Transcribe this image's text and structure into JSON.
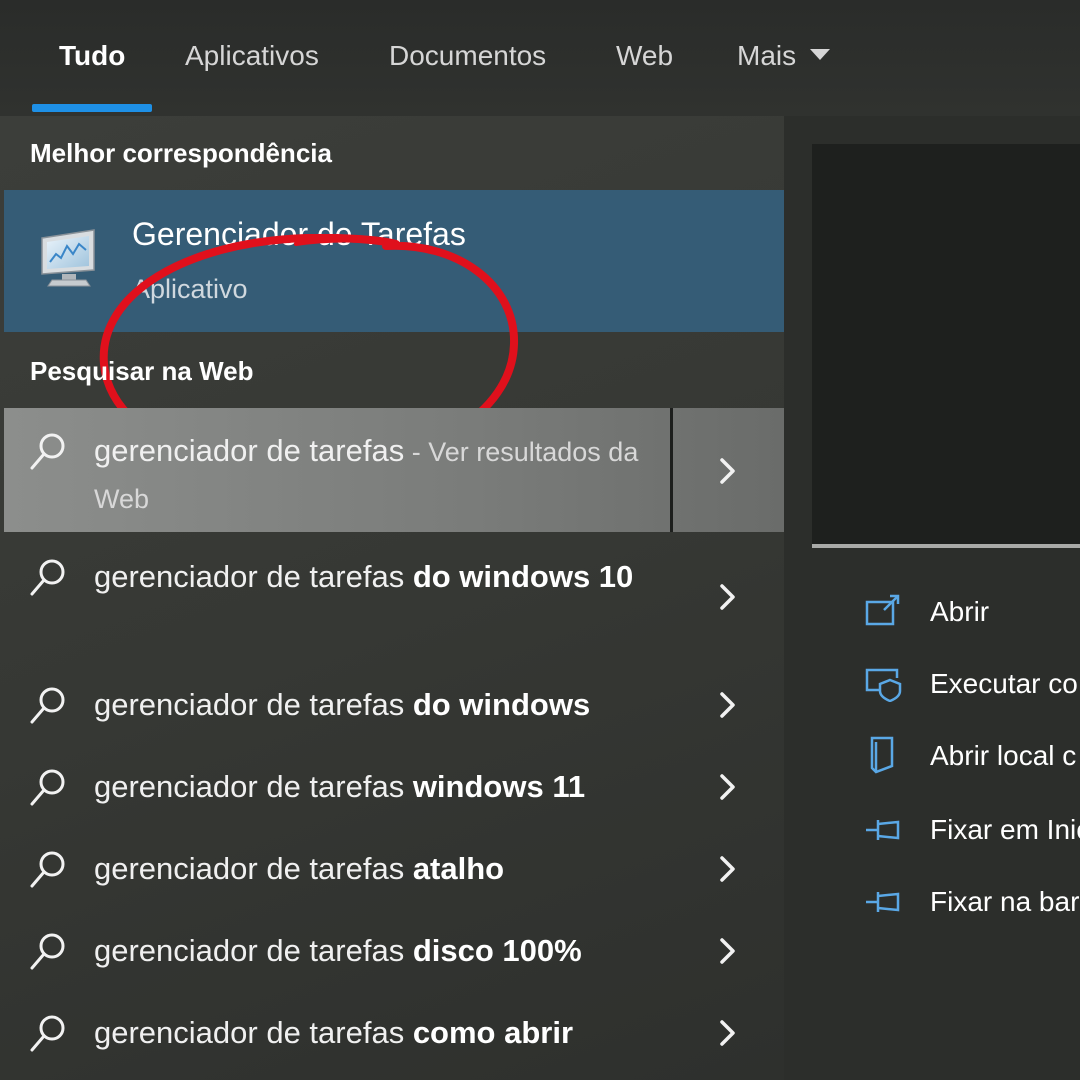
{
  "tabs": [
    {
      "label": "Tudo"
    },
    {
      "label": "Aplicativos"
    },
    {
      "label": "Documentos"
    },
    {
      "label": "Web"
    },
    {
      "label": "Mais"
    }
  ],
  "best_match": {
    "section_title": "Melhor correspondência",
    "app_name": "Gerenciador de Tarefas",
    "app_type": "Aplicativo",
    "icon": "task-manager-icon",
    "annotation_color": "#e0101c"
  },
  "web_search": {
    "section_title": "Pesquisar na Web",
    "rows": [
      {
        "query": "gerenciador de tarefas",
        "bold": "",
        "suffix": " - Ver resultados da Web"
      },
      {
        "query": "gerenciador de tarefas ",
        "bold": "do windows 10",
        "suffix": ""
      },
      {
        "query": "gerenciador de tarefas ",
        "bold": "do windows",
        "suffix": ""
      },
      {
        "query": "gerenciador de tarefas ",
        "bold": "windows 11",
        "suffix": ""
      },
      {
        "query": "gerenciador de tarefas ",
        "bold": "atalho",
        "suffix": ""
      },
      {
        "query": "gerenciador de tarefas ",
        "bold": "disco 100%",
        "suffix": ""
      },
      {
        "query": "gerenciador de tarefas ",
        "bold": "como abrir",
        "suffix": ""
      }
    ]
  },
  "actions": [
    {
      "label": "Abrir",
      "icon": "open-icon"
    },
    {
      "label": "Executar co",
      "icon": "run-as-admin-icon"
    },
    {
      "label": "Abrir local c",
      "icon": "file-location-icon"
    },
    {
      "label": "Fixar em Inic",
      "icon": "pin-icon"
    },
    {
      "label": "Fixar na bar",
      "icon": "pin-icon"
    }
  ],
  "colors": {
    "accent": "#1e90e6",
    "selected_best_match": "#355c76",
    "action_icon": "#5aa8e6"
  }
}
